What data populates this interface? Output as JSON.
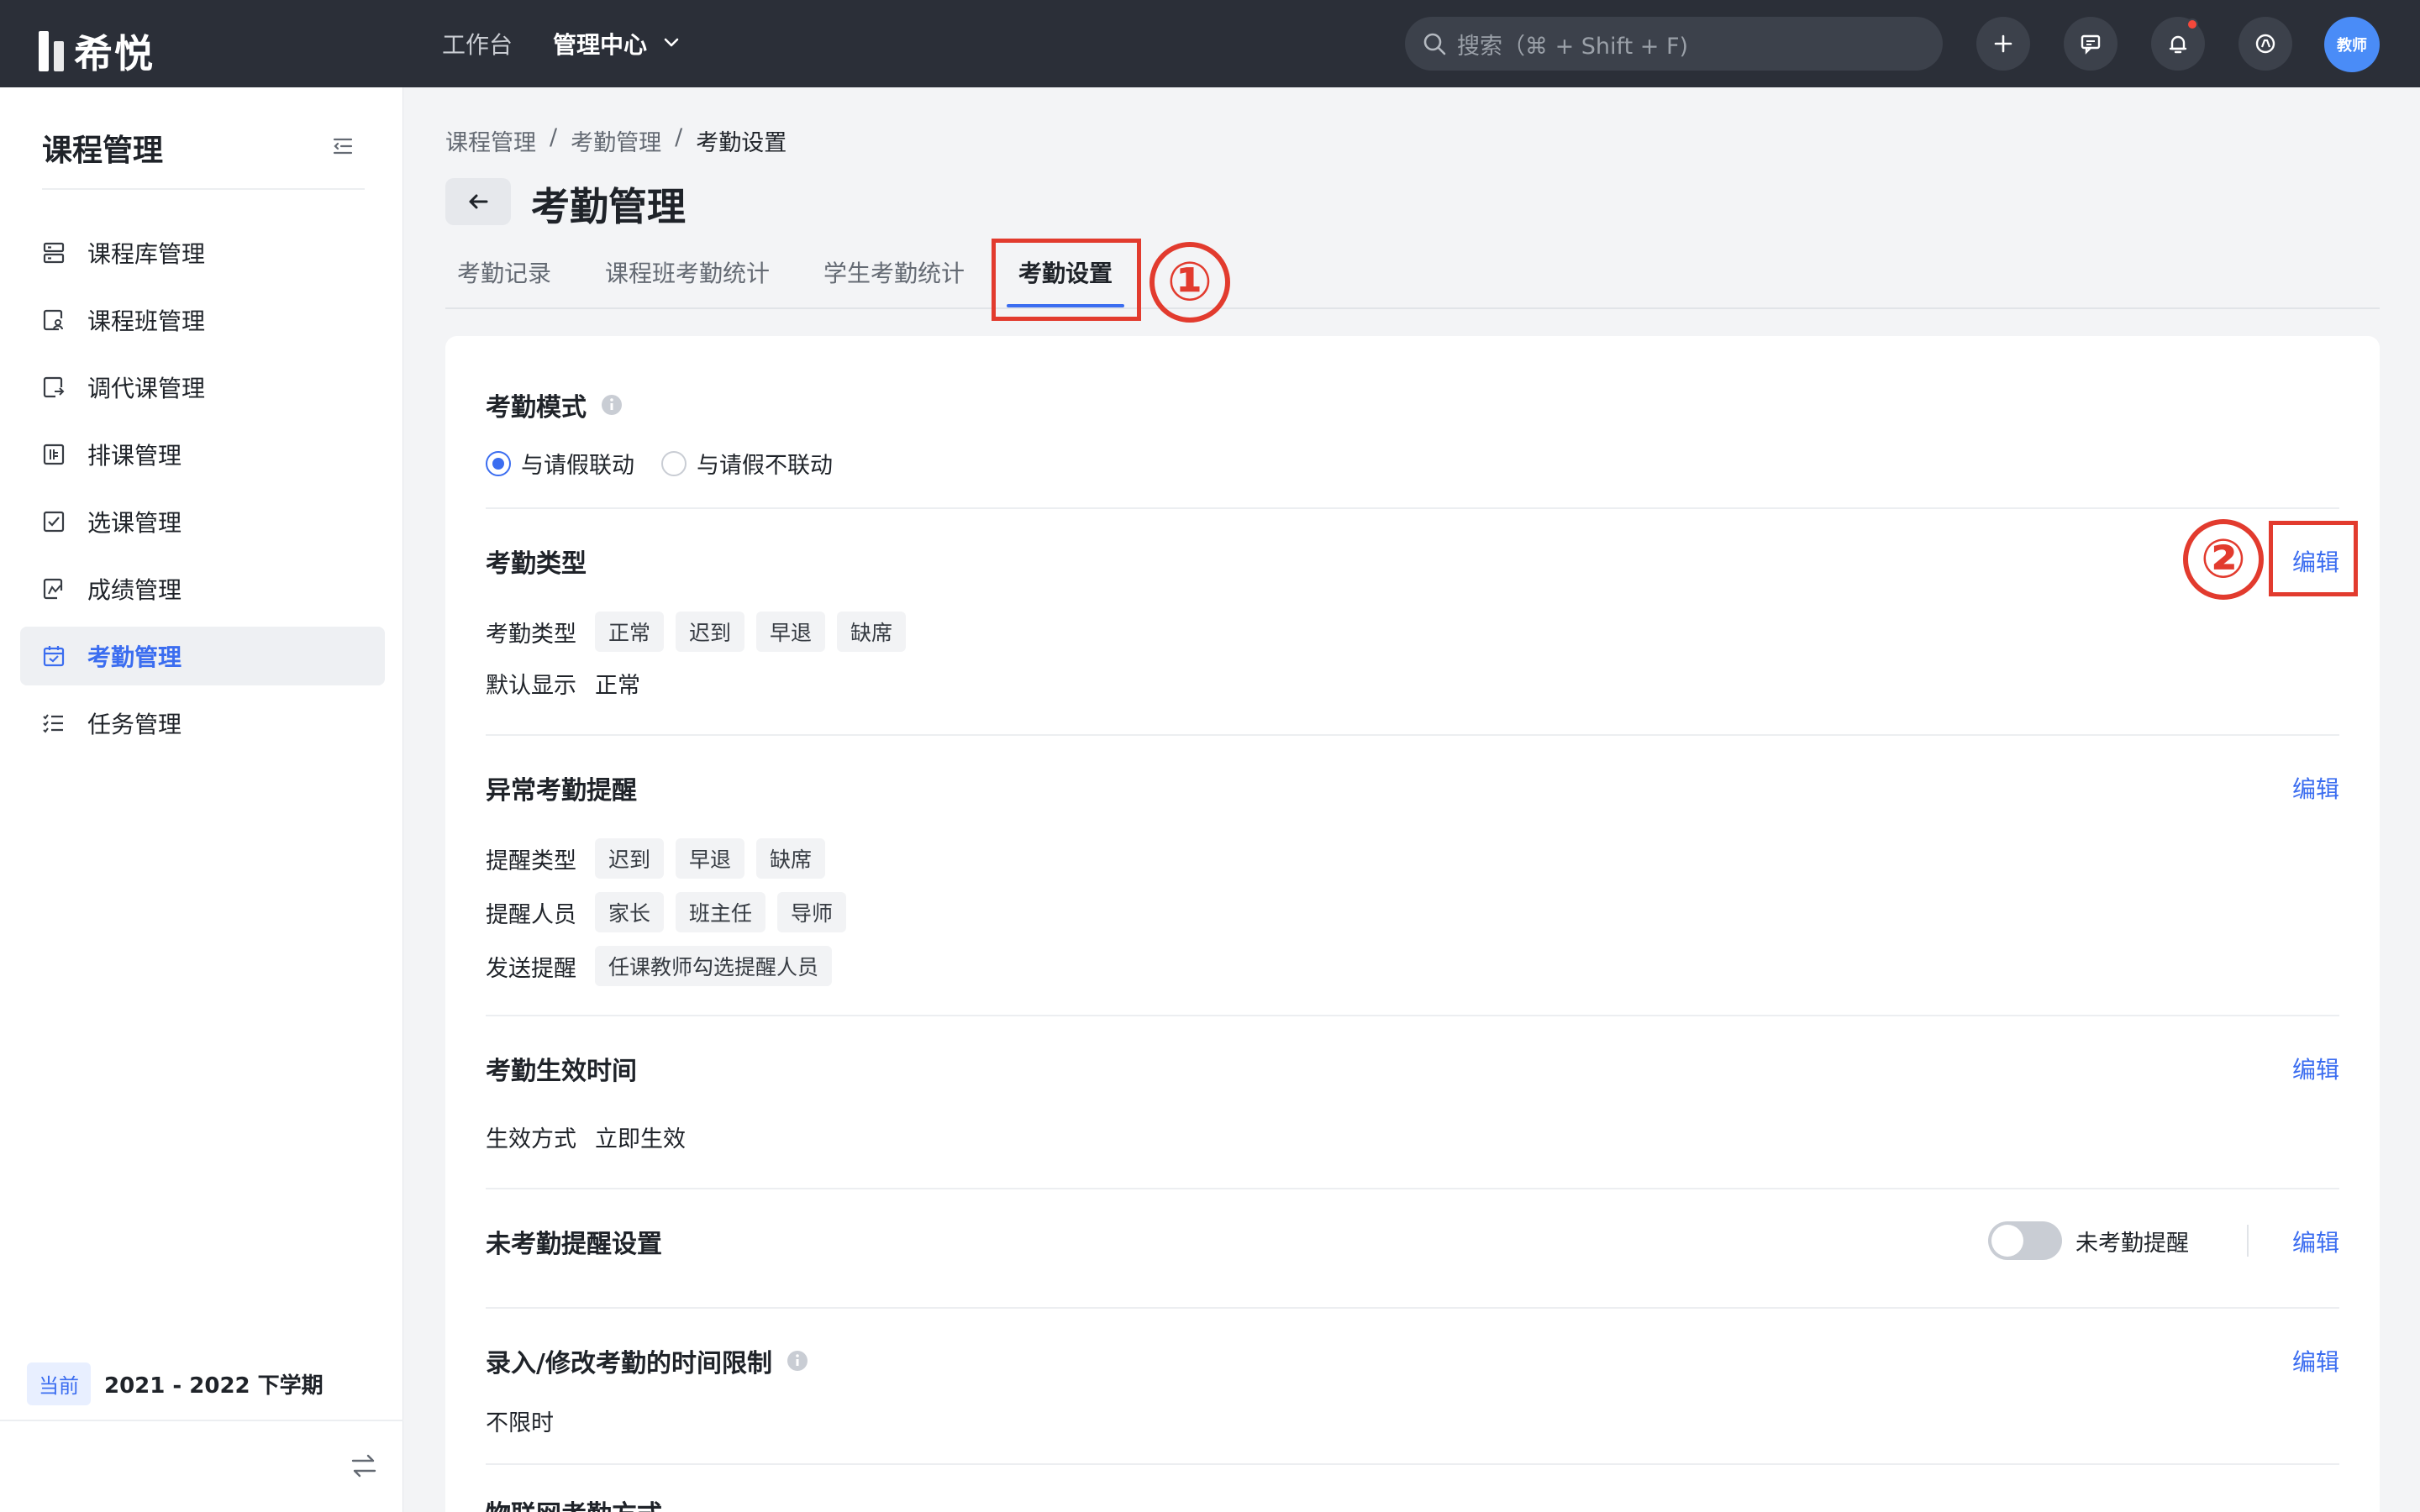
{
  "app": {
    "logo_text": "希悦"
  },
  "topnav": {
    "workbench": "工作台",
    "admin_center": "管理中心"
  },
  "search": {
    "placeholder": "搜索（⌘ + Shift + F)"
  },
  "user": {
    "avatar_text": "教师"
  },
  "sidebar": {
    "title": "课程管理",
    "items": [
      {
        "label": "课程库管理",
        "icon": "database-icon"
      },
      {
        "label": "课程班管理",
        "icon": "class-icon"
      },
      {
        "label": "调代课管理",
        "icon": "swap-icon"
      },
      {
        "label": "排课管理",
        "icon": "schedule-icon"
      },
      {
        "label": "选课管理",
        "icon": "checkbox-icon"
      },
      {
        "label": "成绩管理",
        "icon": "grade-icon"
      },
      {
        "label": "考勤管理",
        "icon": "calendar-check-icon",
        "active": true
      },
      {
        "label": "任务管理",
        "icon": "tasklist-icon"
      }
    ],
    "term_tag": "当前",
    "term": "2021 - 2022 下学期"
  },
  "breadcrumb": [
    "课程管理",
    "考勤管理",
    "考勤设置"
  ],
  "breadcrumb_sep": "/",
  "page_title": "考勤管理",
  "tabs": [
    "考勤记录",
    "课程班考勤统计",
    "学生考勤统计",
    "考勤设置"
  ],
  "active_tab": "考勤设置",
  "annotations": [
    "①",
    "②"
  ],
  "settings": {
    "mode": {
      "title": "考勤模式",
      "options": [
        "与请假联动",
        "与请假不联动"
      ],
      "selected": "与请假联动"
    },
    "types": {
      "title": "考勤类型",
      "edit": "编辑",
      "type_label": "考勤类型",
      "type_values": [
        "正常",
        "迟到",
        "早退",
        "缺席"
      ],
      "default_label": "默认显示",
      "default_value": "正常"
    },
    "abnormal": {
      "title": "异常考勤提醒",
      "edit": "编辑",
      "remind_type_label": "提醒类型",
      "remind_types": [
        "迟到",
        "早退",
        "缺席"
      ],
      "remind_people_label": "提醒人员",
      "remind_people": [
        "家长",
        "班主任",
        "导师"
      ],
      "send_label": "发送提醒",
      "send_value": "任课教师勾选提醒人员"
    },
    "effective": {
      "title": "考勤生效时间",
      "edit": "编辑",
      "mode_label": "生效方式",
      "mode_value": "立即生效"
    },
    "unchecked": {
      "title": "未考勤提醒设置",
      "toggle_label": "未考勤提醒",
      "toggle_on": false,
      "edit": "编辑"
    },
    "time_limit": {
      "title": "录入/修改考勤的时间限制",
      "edit": "编辑",
      "value": "不限时"
    },
    "next_section_partial": "物联网考勤方式"
  },
  "colors": {
    "accent": "#3b6df0",
    "topbar": "#2b2f38",
    "annotation": "#e23b2e"
  }
}
